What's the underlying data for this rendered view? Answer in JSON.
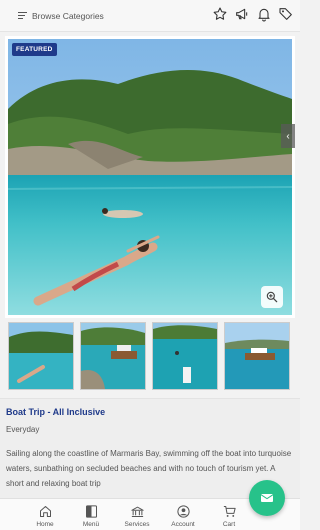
{
  "header": {
    "browse_label": "Browse Categories",
    "icons": [
      "star-icon",
      "megaphone-icon",
      "bell-icon",
      "tags-icon"
    ]
  },
  "gallery": {
    "badge": "FEATURED",
    "thumbnail_count": 4
  },
  "product": {
    "title": "Boat Trip - All Inclusive",
    "frequency": "Everyday",
    "description": "Sailing along the coastline of Marmaris Bay, swimming off the boat into turquoise waters, sunbathing on secluded beaches and with no touch of tourism yet. A short and relaxing boat trip"
  },
  "bottom_nav": {
    "items": [
      {
        "label": "Home",
        "icon": "home-icon"
      },
      {
        "label": "Menü",
        "icon": "menu-book-icon"
      },
      {
        "label": "Services",
        "icon": "services-icon"
      },
      {
        "label": "Account",
        "icon": "account-icon"
      },
      {
        "label": "Cart",
        "icon": "cart-icon"
      }
    ]
  },
  "colors": {
    "accent": "#1f3a8a",
    "fab": "#27c28a"
  }
}
